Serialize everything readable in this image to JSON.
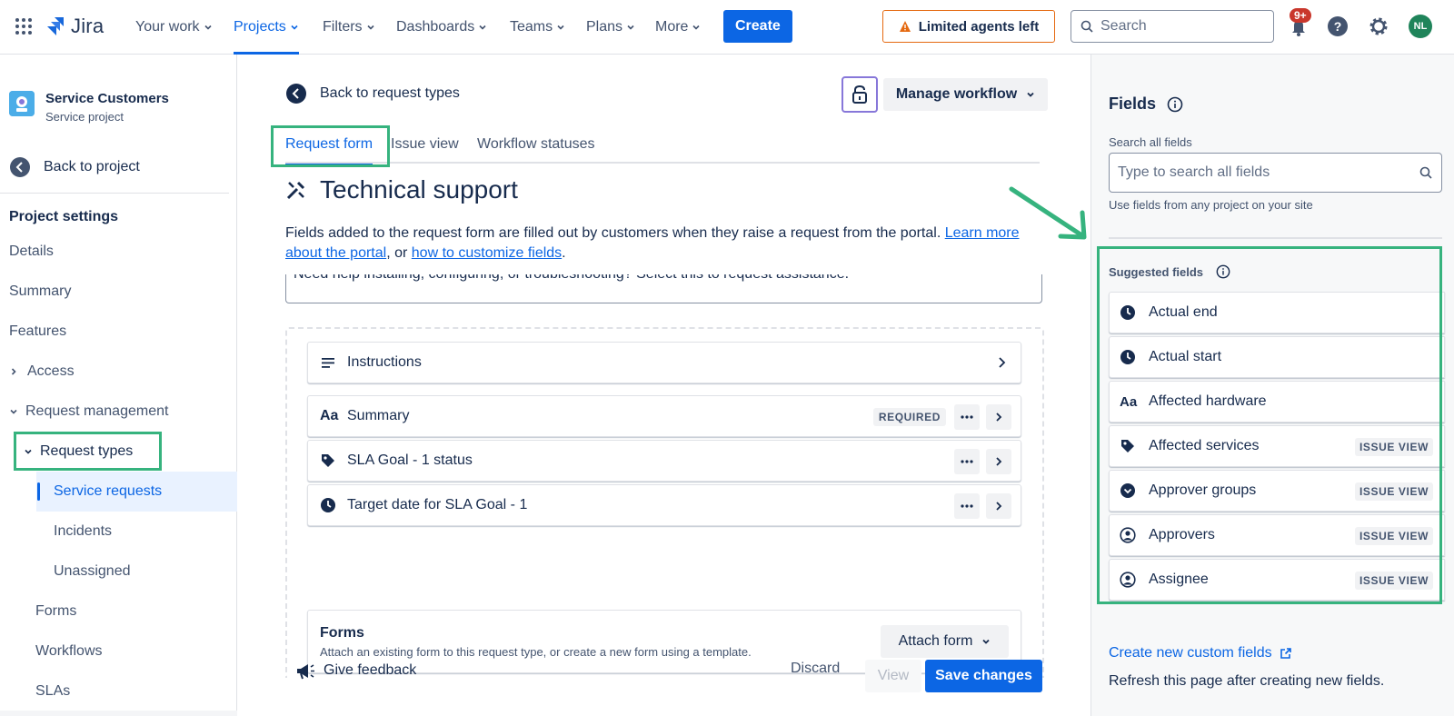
{
  "topnav": {
    "logo": "Jira",
    "items": [
      "Your work",
      "Projects",
      "Filters",
      "Dashboards",
      "Teams",
      "Plans",
      "More"
    ],
    "create_label": "Create",
    "limited_label": "Limited agents left",
    "search_placeholder": "Search",
    "notification_badge": "9+",
    "avatar_initials": "NL"
  },
  "sidebar": {
    "project_name": "Service Customers",
    "project_type": "Service project",
    "back_label": "Back to project",
    "heading": "Project settings",
    "items": {
      "details": "Details",
      "summary": "Summary",
      "features": "Features",
      "access": "Access",
      "request_management": "Request management",
      "request_types": "Request types",
      "service_requests": "Service requests",
      "incidents": "Incidents",
      "unassigned": "Unassigned",
      "forms": "Forms",
      "workflows": "Workflows",
      "slas": "SLAs"
    }
  },
  "main": {
    "back_label": "Back to request types",
    "manage_workflow": "Manage workflow",
    "tabs": [
      "Request form",
      "Issue view",
      "Workflow statuses"
    ],
    "title": "Technical support",
    "desc_text": "Fields added to the request form are filled out by customers when they raise a request from the portal. ",
    "desc_link1": "Learn more about the portal",
    "desc_mid": ", or ",
    "desc_link2": "how to customize fields",
    "desc_end": ".",
    "desc_box_text": "Need help installing, configuring, or troubleshooting? Select this to request assistance.",
    "rows": [
      {
        "label": "Instructions"
      },
      {
        "label": "Summary",
        "badge": "REQUIRED"
      },
      {
        "label": "SLA Goal - 1 status"
      },
      {
        "label": "Target date for SLA Goal - 1"
      }
    ],
    "forms_title": "Forms",
    "forms_sub": "Attach an existing form to this request type, or create a new form using a template.",
    "attach_form": "Attach form",
    "give_feedback": "Give feedback",
    "discard": "Discard",
    "view": "View",
    "save_changes": "Save changes"
  },
  "rpanel": {
    "title": "Fields",
    "search_label": "Search all fields",
    "search_placeholder": "Type to search all fields",
    "search_help": "Use fields from any project on your site",
    "suggested_title": "Suggested fields",
    "fields": [
      {
        "label": "Actual end",
        "icon": "clock-icon"
      },
      {
        "label": "Actual start",
        "icon": "clock-icon"
      },
      {
        "label": "Affected hardware",
        "icon": "text-icon"
      },
      {
        "label": "Affected services",
        "icon": "tag-icon",
        "badge": "ISSUE VIEW"
      },
      {
        "label": "Approver groups",
        "icon": "chevron-circle-icon",
        "badge": "ISSUE VIEW"
      },
      {
        "label": "Approvers",
        "icon": "person-icon",
        "badge": "ISSUE VIEW"
      },
      {
        "label": "Assignee",
        "icon": "person-icon",
        "badge": "ISSUE VIEW"
      }
    ],
    "create_custom": "Create new custom fields",
    "refresh_note": "Refresh this page after creating new fields."
  },
  "colors": {
    "accent": "#0c66e4",
    "highlight": "#36b37e",
    "warning": "#e56910"
  }
}
